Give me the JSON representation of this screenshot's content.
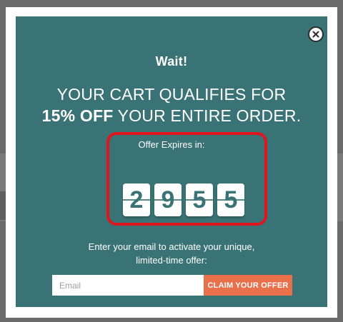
{
  "popup": {
    "title": "Wait!",
    "headline_line1": "YOUR CART QUALIFIES FOR",
    "headline_bold": "15% OFF",
    "headline_rest": " YOUR ENTIRE ORDER.",
    "timer_label": "Offer Expires in:",
    "timer_digits": [
      "2",
      "9",
      "5",
      "5"
    ],
    "prompt_line1": "Enter your email to activate your unique,",
    "prompt_line2": "limited-time offer:",
    "email_placeholder": "Email",
    "email_value": "",
    "claim_label": "CLAIM YOUR OFFER",
    "close_icon": "close-icon"
  },
  "colors": {
    "modal_bg": "#3a7375",
    "accent_button": "#e8714c",
    "timer_highlight": "#e0151d",
    "overlay": "#6b6b6b"
  }
}
